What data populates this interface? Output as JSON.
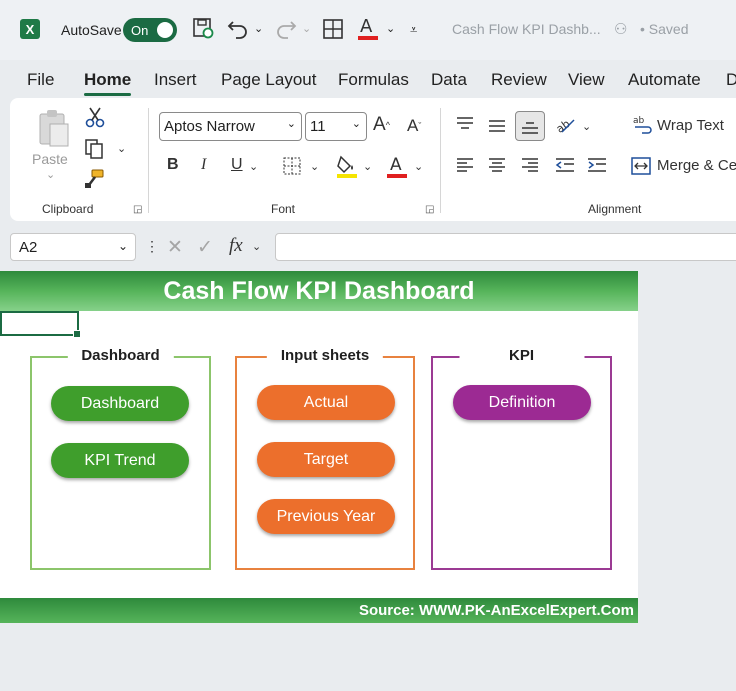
{
  "titlebar": {
    "logo": "X",
    "autosave_label": "AutoSave",
    "autosave_state": "On",
    "doc_title": "Cash Flow KPI Dashb...",
    "saved_status": "• Saved"
  },
  "tabs": [
    "File",
    "Home",
    "Insert",
    "Page Layout",
    "Formulas",
    "Data",
    "Review",
    "View",
    "Automate",
    "D"
  ],
  "active_tab": "Home",
  "ribbon": {
    "clipboard": {
      "label": "Clipboard",
      "paste_label": "Paste"
    },
    "font": {
      "label": "Font",
      "font_name": "Aptos Narrow",
      "font_size": "11",
      "bold": "B",
      "italic": "I",
      "underline": "U"
    },
    "alignment": {
      "label": "Alignment",
      "wrap_text": "Wrap Text",
      "merge_center": "Merge & Ce"
    }
  },
  "formula_bar": {
    "name_box": "A2",
    "fx": "fx",
    "value": ""
  },
  "sheet": {
    "title": "Cash Flow KPI Dashboard",
    "groups": [
      {
        "title": "Dashboard",
        "color": "#8cc56b",
        "buttons": [
          "Dashboard",
          "KPI Trend"
        ],
        "button_color": "#3f9e2c"
      },
      {
        "title": "Input sheets",
        "color": "#e8823f",
        "buttons": [
          "Actual",
          "Target",
          "Previous Year"
        ],
        "button_color": "#ec6f2c"
      },
      {
        "title": "KPI",
        "color": "#9b3a93",
        "buttons": [
          "Definition"
        ],
        "button_color": "#9c2a93"
      }
    ],
    "footer": "Source: WWW.PK-AnExcelExpert.Com"
  },
  "colors": {
    "excel_green": "#1b6b43",
    "header_green": "#56b45a"
  }
}
